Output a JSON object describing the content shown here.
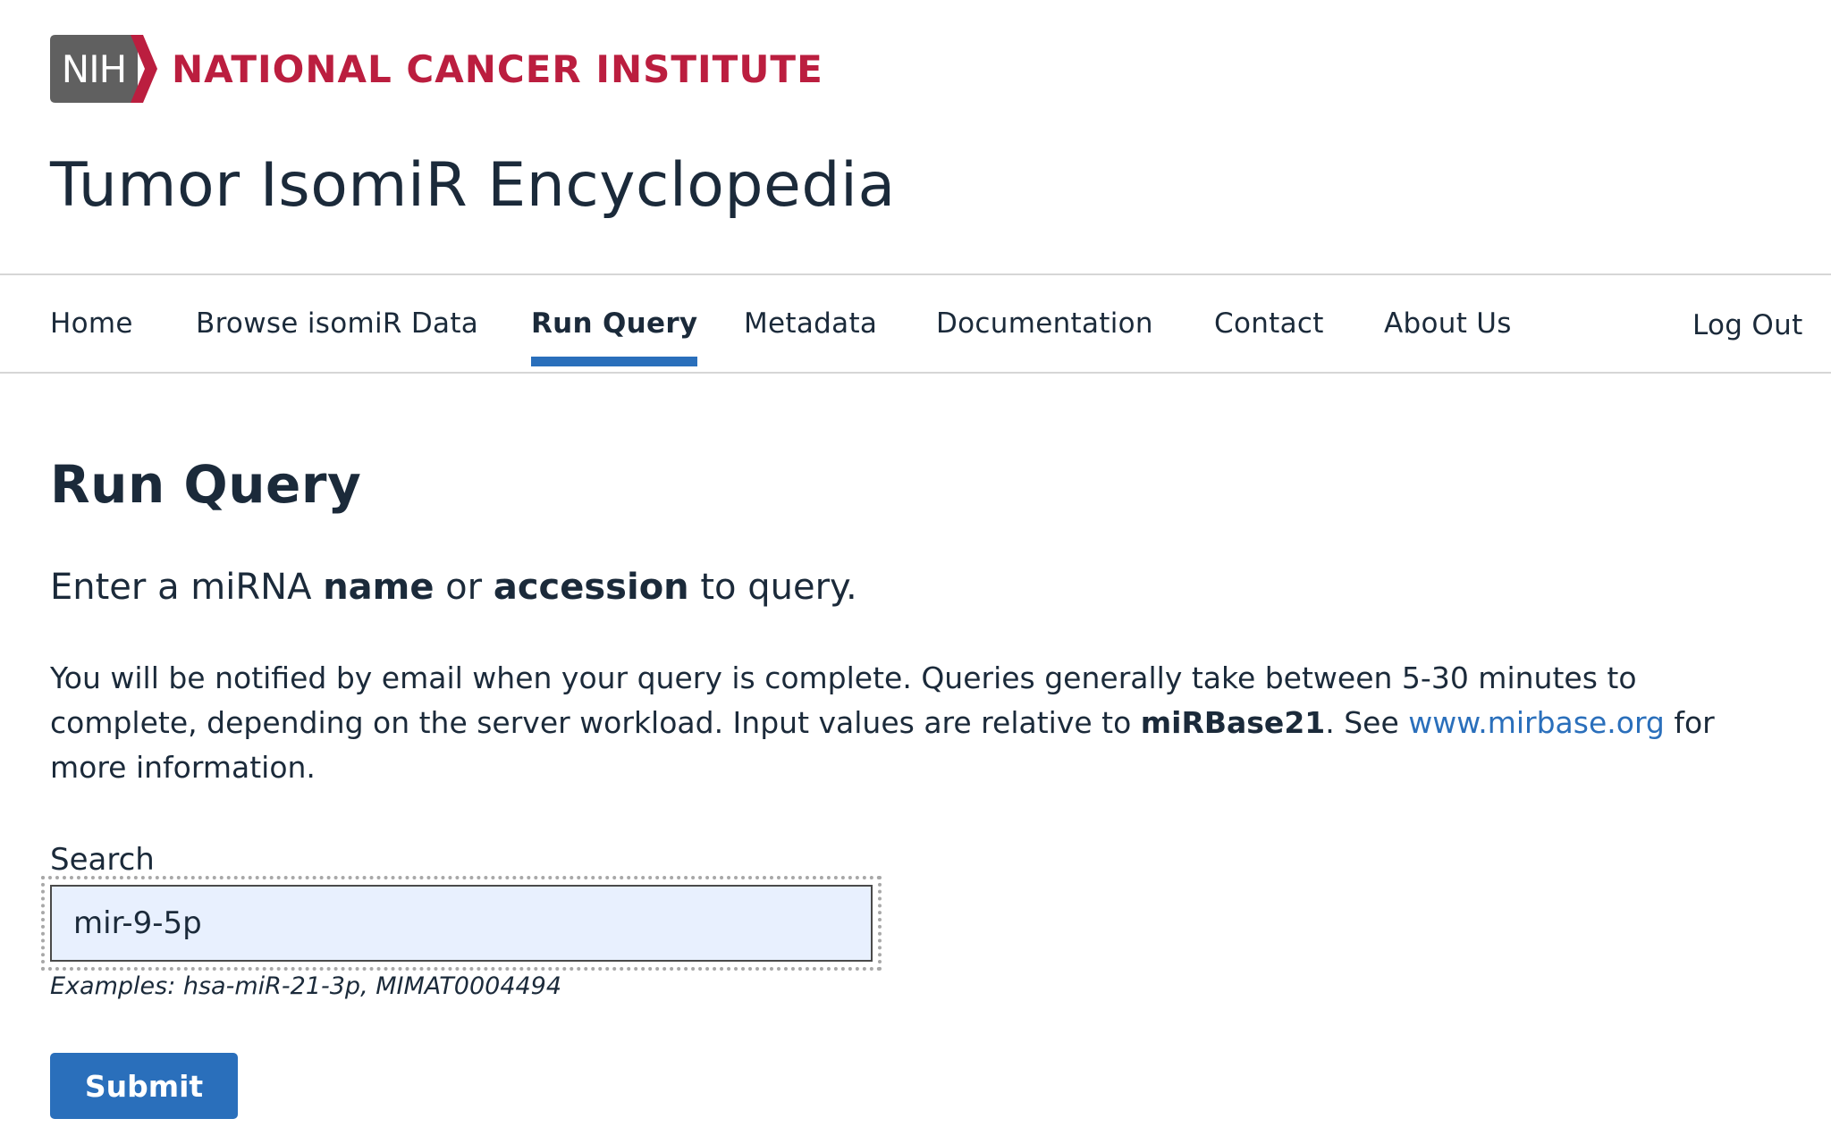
{
  "header": {
    "logo_text": "NIH",
    "org_name": "NATIONAL CANCER INSTITUTE",
    "site_title": "Tumor IsomiR Encyclopedia",
    "colors": {
      "org_red": "#bb1e3f",
      "logo_gray": "#606060"
    }
  },
  "nav": {
    "items": [
      {
        "label": "Home"
      },
      {
        "label": "Browse isomiR Data"
      },
      {
        "label": "Run Query",
        "active": true
      },
      {
        "label": "Metadata"
      },
      {
        "label": "Documentation"
      },
      {
        "label": "Contact"
      },
      {
        "label": "About Us"
      }
    ],
    "logout_label": "Log Out",
    "accent_color": "#2a6fbb"
  },
  "main": {
    "title": "Run Query",
    "lede": {
      "part1": "Enter a miRNA ",
      "bold1": "name",
      "part2": " or ",
      "bold2": "accession",
      "part3": " to query."
    },
    "info": {
      "text1": "You will be notified by email when your query is complete. Queries generally take between 5-30 minutes to complete, depending on the server workload. Input values are relative to ",
      "bold": "miRBase21",
      "text2": ". See ",
      "link": "www.mirbase.org",
      "text3": " for more information."
    },
    "search": {
      "label": "Search",
      "value": "mir-9-5p",
      "examples": "Examples: hsa-miR-21-3p, MIMAT0004494"
    },
    "submit_label": "Submit"
  }
}
